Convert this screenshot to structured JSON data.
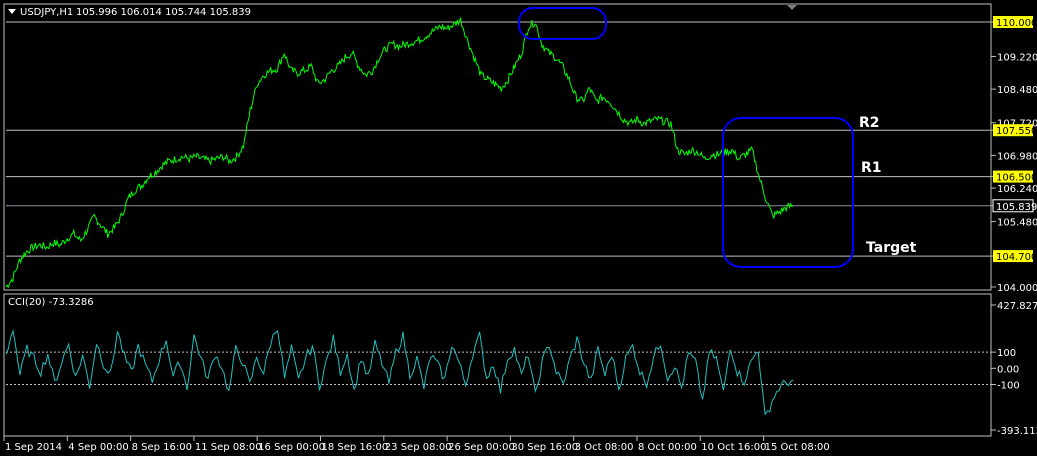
{
  "header": {
    "symbol": "USDJPY,H1",
    "ohlc": "105.996 106.014 105.744 105.839",
    "menu_icon": "triangle-down-icon"
  },
  "indicator": {
    "label": "CCI(20) -73.3286"
  },
  "annotations": {
    "r2": "R2",
    "r1": "R1",
    "target": "Target"
  },
  "colors": {
    "price": "#00ff00",
    "cci": "#20c0c0",
    "highlight": "#0000ff",
    "level_box": "#ffff00",
    "grid": "#c0c0c0"
  },
  "chart_data": [
    {
      "type": "line",
      "title": "USDJPY,H1",
      "y_ticks": [
        "110.000",
        "109.220",
        "108.480",
        "107.720",
        "107.550",
        "106.980",
        "106.500",
        "106.240",
        "105.839",
        "105.480",
        "104.700",
        "104.000"
      ],
      "highlighted_levels": [
        {
          "value": 110.0,
          "label": "110.000"
        },
        {
          "value": 107.55,
          "label": "107.550"
        },
        {
          "value": 106.5,
          "label": "106.500"
        },
        {
          "value": 104.7,
          "label": "104.700"
        }
      ],
      "current_price": {
        "value": 105.839,
        "label": "105.839"
      },
      "x_ticks": [
        "1 Sep 2014",
        "4 Sep 00:00",
        "8 Sep 16:00",
        "11 Sep 08:00",
        "16 Sep 00:00",
        "18 Sep 16:00",
        "23 Sep 08:00",
        "26 Sep 00:00",
        "30 Sep 16:00",
        "3 Oct 08:00",
        "8 Oct 00:00",
        "10 Oct 16:00",
        "15 Oct 08:00"
      ],
      "ylim": [
        104.0,
        110.3
      ],
      "series": [
        {
          "values": [
            104.0,
            104.2,
            104.6,
            104.8,
            104.9,
            104.95,
            104.9,
            105.0,
            104.95,
            105.1,
            105.2,
            105.05,
            105.3,
            105.6,
            105.4,
            105.2,
            105.35,
            105.6,
            106.0,
            106.2,
            106.3,
            106.5,
            106.6,
            106.75,
            106.85,
            106.9,
            106.95,
            106.9,
            106.95,
            106.9,
            106.85,
            106.9,
            106.95,
            106.85,
            106.95,
            107.2,
            108.0,
            108.6,
            108.8,
            108.9,
            108.95,
            109.3,
            108.9,
            108.85,
            108.9,
            109.0,
            108.6,
            108.7,
            108.9,
            109.0,
            109.2,
            109.3,
            109.0,
            108.8,
            108.9,
            109.2,
            109.4,
            109.5,
            109.45,
            109.5,
            109.55,
            109.6,
            109.7,
            109.8,
            109.9,
            109.85,
            109.95,
            110.05,
            109.6,
            109.2,
            108.8,
            108.7,
            108.6,
            108.5,
            108.7,
            109.0,
            109.3,
            109.9,
            110.0,
            109.5,
            109.3,
            109.2,
            109.0,
            108.7,
            108.3,
            108.2,
            108.5,
            108.2,
            108.3,
            108.2,
            108.0,
            107.8,
            107.7,
            107.8,
            107.7,
            107.75,
            107.8,
            107.75,
            107.7,
            107.1,
            107.0,
            107.1,
            107.05,
            106.9,
            107.0,
            107.0,
            107.05,
            107.1,
            106.9,
            107.0,
            107.1,
            106.5,
            106.0,
            105.6,
            105.7,
            105.8,
            105.84
          ]
        }
      ]
    },
    {
      "type": "line",
      "title": "CCI(20) -73.3286",
      "y_ticks": [
        "427.8279",
        "100",
        "0.00",
        "-100",
        "-393.1132"
      ],
      "ylim": [
        -393.1132,
        427.8279
      ],
      "levels": [
        100,
        -100
      ],
      "series": [
        {
          "values": [
            80,
            250,
            -40,
            120,
            60,
            -20,
            90,
            -90,
            40,
            150,
            -60,
            80,
            -110,
            160,
            30,
            -40,
            230,
            70,
            -30,
            140,
            20,
            -80,
            60,
            180,
            -50,
            40,
            -120,
            200,
            60,
            -70,
            90,
            10,
            -150,
            120,
            40,
            -100,
            70,
            -30,
            160,
            260,
            -60,
            120,
            -80,
            60,
            140,
            -110,
            40,
            180,
            -20,
            90,
            -140,
            70,
            -60,
            150,
            30,
            -90,
            100,
            200,
            -40,
            60,
            -120,
            80,
            20,
            -70,
            150,
            40,
            -100,
            90,
            200,
            -60,
            30,
            -140,
            60,
            120,
            -50,
            90,
            -170,
            40,
            150,
            -20,
            -100,
            60,
            180,
            30,
            -80,
            120,
            -40,
            90,
            -130,
            60,
            140,
            -20,
            -90,
            70,
            160,
            -60,
            20,
            -120,
            90,
            40,
            -200,
            100,
            60,
            -150,
            140,
            -20,
            -80,
            40,
            120,
            -310,
            -200,
            -120,
            -90,
            -73
          ]
        }
      ]
    }
  ]
}
